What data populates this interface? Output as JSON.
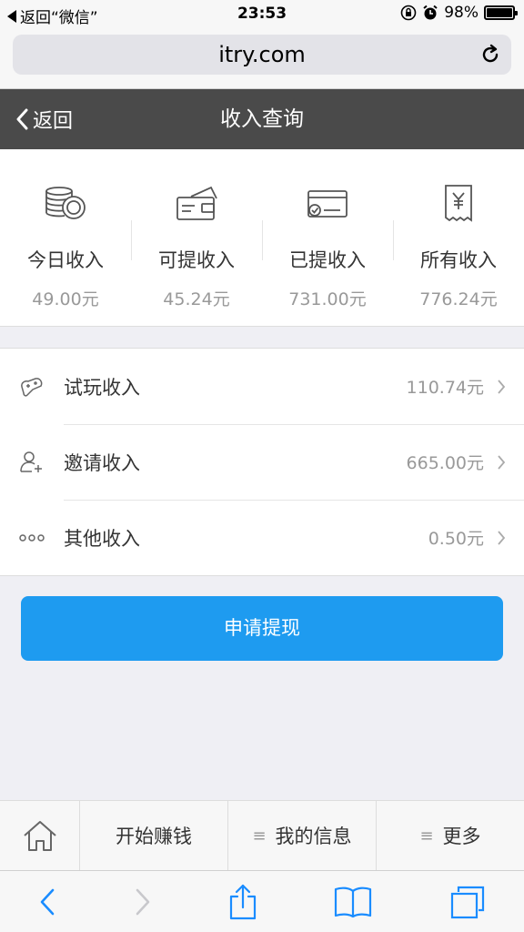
{
  "status_bar": {
    "back_app": "返回“微信”",
    "time": "23:53",
    "battery": "98%"
  },
  "browser": {
    "url": "itry.com"
  },
  "header": {
    "back_label": "返回",
    "title": "收入查询"
  },
  "summary": [
    {
      "label": "今日收入",
      "value": "49.00元",
      "icon": "coins-icon"
    },
    {
      "label": "可提收入",
      "value": "45.24元",
      "icon": "wallet-card-icon"
    },
    {
      "label": "已提收入",
      "value": "731.00元",
      "icon": "card-check-icon"
    },
    {
      "label": "所有收入",
      "value": "776.24元",
      "icon": "receipt-yen-icon"
    }
  ],
  "income_list": [
    {
      "label": "试玩收入",
      "value": "110.74元",
      "icon": "gamepad-icon"
    },
    {
      "label": "邀请收入",
      "value": "665.00元",
      "icon": "add-user-icon"
    },
    {
      "label": "其他收入",
      "value": "0.50元",
      "icon": "more-dots-icon"
    }
  ],
  "apply_button": "申请提现",
  "bottom_nav": {
    "start_earning": "开始赚钱",
    "my_info": "我的信息",
    "more": "更多"
  },
  "colors": {
    "header_bg": "#4a4a4a",
    "accent": "#1e9bf0",
    "safari_blue": "#1a8cff"
  }
}
